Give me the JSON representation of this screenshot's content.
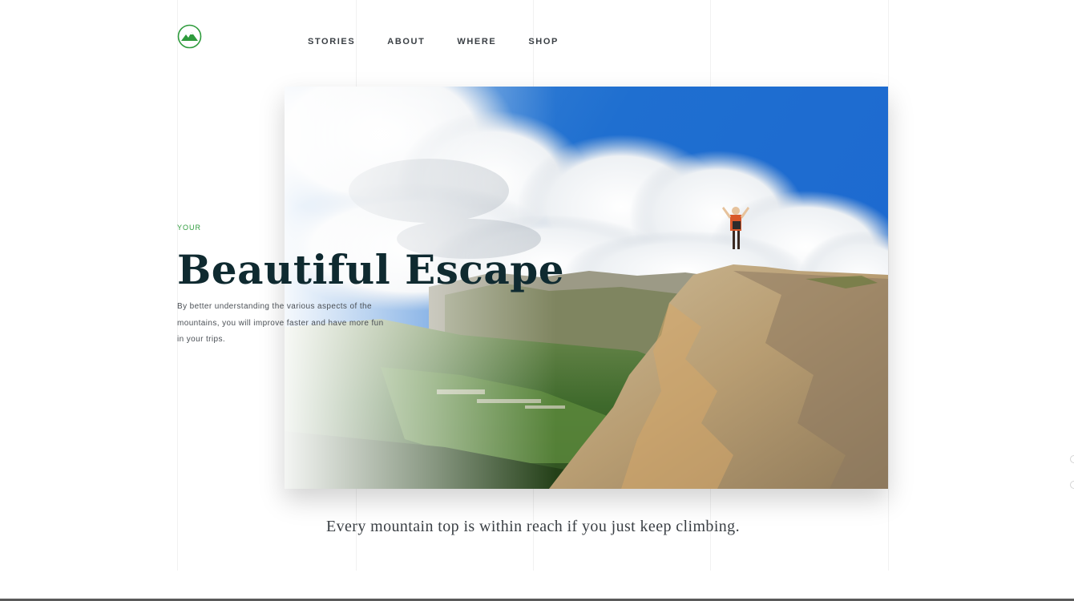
{
  "nav": {
    "items": [
      {
        "label": "STORIES"
      },
      {
        "label": "ABOUT"
      },
      {
        "label": "WHERE"
      },
      {
        "label": "SHOP"
      }
    ]
  },
  "hero": {
    "kicker": "YOUR",
    "title": "Beautiful Escape",
    "body": "By better understanding the various aspects of the mountains, you will improve faster and have more fun in your trips.",
    "quote": "Every mountain top is within reach if you just keep climbing."
  },
  "icons": {
    "logo": "mountain-logo-icon",
    "brand_color": "#2e9b3c"
  },
  "colors": {
    "headline": "#0f2a30",
    "accent": "#2e9b3c",
    "sky": "#1f73d2"
  }
}
